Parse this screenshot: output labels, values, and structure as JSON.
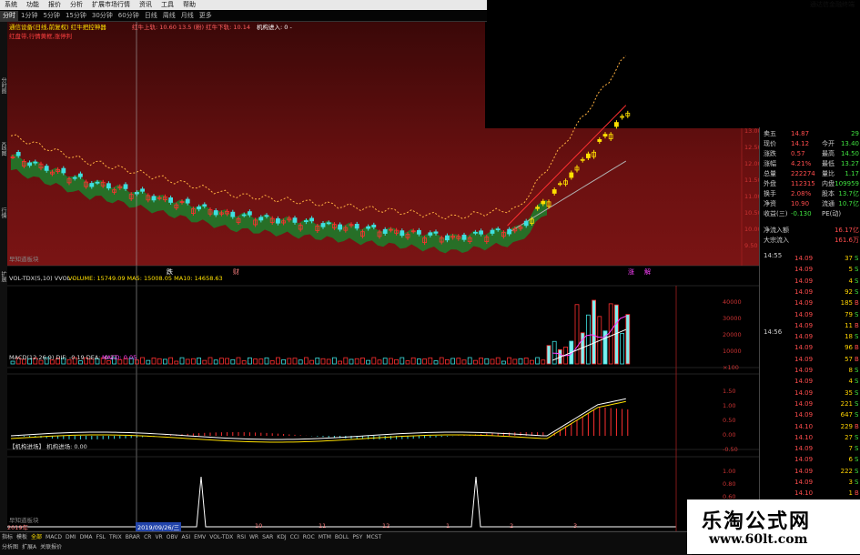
{
  "window": {
    "title": "通达信金融终端",
    "menu": [
      "系统",
      "功能",
      "报价",
      "分析",
      "扩展市场行情",
      "资讯",
      "工具",
      "帮助"
    ]
  },
  "periods": {
    "items": [
      "分时",
      "1分钟",
      "5分钟",
      "15分钟",
      "30分钟",
      "60分钟",
      "日线",
      "周线",
      "月线",
      "更多"
    ],
    "active": 0
  },
  "indicators": {
    "main_header": "通信设备(日线,前复权) 红牛把控神器",
    "main_header_vals": "红牛上轨: 10.60  13.5 (粉)  红牛下轨: 10.14",
    "main_header_b": "机构进入: 0 -",
    "main_sub": "红盘带,行情黄框,涨停判",
    "main_note": "早知道板块",
    "vol_header": "VOL-TDX(5,10) VVOL -",
    "vol_vals": "VOLUME: 15749.09  MA5: 15008.05  MA10: 14658.63",
    "macd_header": "MACD(12,26,9) DIF: -0.19 DEA: -0.21",
    "macd_val": "MACD: 0.05",
    "inst_header": "【机构进场】 机构进场: 0.00",
    "inst_note": "早知道板块",
    "sidebar_tabs": [
      "分时图",
      "K线图",
      "行情",
      "扩展"
    ]
  },
  "price_labels": [
    "13.00",
    "12.50",
    "12.00",
    "11.50",
    "11.00",
    "10.50",
    "10.00",
    "9.50"
  ],
  "vol_labels": [
    "40000",
    "30000",
    "20000",
    "10000",
    "×100"
  ],
  "macd_labels": [
    "1.50",
    "1.00",
    "0.50",
    "0.00",
    "-0.50"
  ],
  "inst_labels": [
    "1.00",
    "0.80",
    "0.60",
    "0.40",
    "0.20",
    "0.00"
  ],
  "events": {
    "date_cursor": "2019/09/26/三",
    "year": "2019年",
    "months": [
      "10",
      "11",
      "12",
      "1",
      "2",
      "3"
    ],
    "labels": [
      "跌",
      "财",
      "涨",
      "解"
    ]
  },
  "quote": {
    "rows": [
      {
        "l1": "卖五",
        "v1": "14.87",
        "l2": "",
        "v2": "29"
      },
      {
        "l1": "现价",
        "v1": "14.12",
        "l2": "今开",
        "v2": "13.40"
      },
      {
        "l1": "涨跌",
        "v1": "0.57",
        "l2": "最高",
        "v2": "14.50"
      },
      {
        "l1": "涨幅",
        "v1": "4.21%",
        "l2": "最低",
        "v2": "13.27"
      },
      {
        "l1": "总量",
        "v1": "222274",
        "l2": "量比",
        "v2": "1.17"
      },
      {
        "l1": "外盘",
        "v1": "112315",
        "l2": "内盘",
        "v2": "109959"
      },
      {
        "l1": "换手",
        "v1": "2.08%",
        "l2": "股本",
        "v2": "13.7亿"
      },
      {
        "l1": "净资",
        "v1": "10.90",
        "l2": "流通",
        "v2": "10.7亿"
      },
      {
        "l1": "收益(三)",
        "v1": "-0.130",
        "l2": "PE(动)",
        "v2": ""
      }
    ],
    "flow_in": {
      "label": "净流入额",
      "value": "16.17亿"
    },
    "big_in": {
      "label": "大宗流入",
      "value": "161.6万"
    },
    "time1": "14:55",
    "time2": "14:56",
    "ticks": [
      {
        "p": "14.09",
        "v": "37",
        "d": "S"
      },
      {
        "p": "14.09",
        "v": "5",
        "d": "S"
      },
      {
        "p": "14.09",
        "v": "4",
        "d": "S"
      },
      {
        "p": "14.09",
        "v": "92",
        "d": "S"
      },
      {
        "p": "14.09",
        "v": "185",
        "d": "B"
      },
      {
        "p": "14.09",
        "v": "79",
        "d": "S"
      },
      {
        "p": "14.09",
        "v": "11",
        "d": "B"
      },
      {
        "p": "14.09",
        "v": "18",
        "d": "S"
      },
      {
        "p": "14.09",
        "v": "96",
        "d": "B"
      },
      {
        "p": "14.09",
        "v": "57",
        "d": "B"
      },
      {
        "p": "14.09",
        "v": "8",
        "d": "S"
      },
      {
        "p": "14.09",
        "v": "4",
        "d": "S"
      },
      {
        "p": "14.09",
        "v": "35",
        "d": "S"
      },
      {
        "p": "14.09",
        "v": "221",
        "d": "S"
      },
      {
        "p": "14.09",
        "v": "647",
        "d": "S"
      },
      {
        "p": "14.10",
        "v": "229",
        "d": "B"
      },
      {
        "p": "14.10",
        "v": "27",
        "d": "S"
      },
      {
        "p": "14.09",
        "v": "7",
        "d": "S"
      },
      {
        "p": "14.09",
        "v": "6",
        "d": "S"
      },
      {
        "p": "14.09",
        "v": "222",
        "d": "S"
      },
      {
        "p": "14.09",
        "v": "3",
        "d": "S"
      },
      {
        "p": "14.10",
        "v": "1",
        "d": "B"
      }
    ]
  },
  "bottom": {
    "row1": [
      "指标",
      "模板",
      "全部",
      "MACD",
      "DMI",
      "DMA",
      "FSL",
      "TRIX",
      "BRAR",
      "CR",
      "VR",
      "OBV",
      "ASI",
      "EMV",
      "VOL-TDX",
      "RSI",
      "WR",
      "SAR",
      "KDJ",
      "CCI",
      "ROC",
      "MTM",
      "BOLL",
      "PSY",
      "MCST"
    ],
    "row2": [
      "分析图",
      "扩展A",
      "关联报价"
    ]
  },
  "watermark": {
    "title": "乐淘公式网",
    "url": "www.60lt.com"
  },
  "colors": {
    "up": "#ff3030",
    "down": "#3fe0e0",
    "yellow": "#ffe000",
    "green_band": "#1f7a2a",
    "bg_red": "#5a0a0a"
  }
}
